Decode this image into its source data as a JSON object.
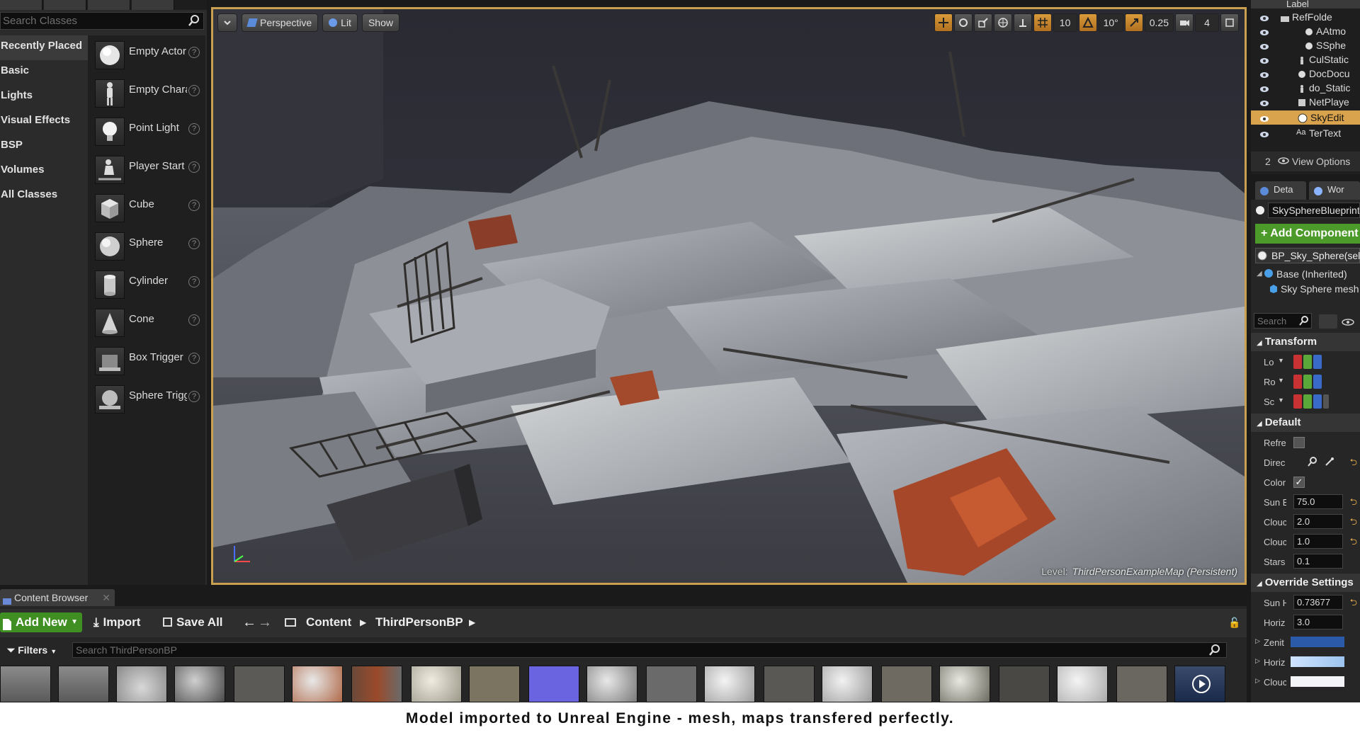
{
  "modes": {
    "search_placeholder": "Search Classes",
    "categories": [
      "Recently Placed",
      "Basic",
      "Lights",
      "Visual Effects",
      "BSP",
      "Volumes",
      "All Classes"
    ],
    "classes": [
      {
        "name": "Empty Actor",
        "icon": "sphere-icon"
      },
      {
        "name": "Empty Character",
        "icon": "character-icon"
      },
      {
        "name": "Point Light",
        "icon": "light-bulb-icon"
      },
      {
        "name": "Player Start",
        "icon": "player-start-icon"
      },
      {
        "name": "Cube",
        "icon": "cube-icon"
      },
      {
        "name": "Sphere",
        "icon": "sphere-icon"
      },
      {
        "name": "Cylinder",
        "icon": "cylinder-icon"
      },
      {
        "name": "Cone",
        "icon": "cone-icon"
      },
      {
        "name": "Box Trigger",
        "icon": "box-trigger-icon"
      },
      {
        "name": "Sphere Trigger",
        "icon": "sphere-trigger-icon"
      }
    ],
    "help_glyph": "?"
  },
  "viewport": {
    "perspective_label": "Perspective",
    "lit_label": "Lit",
    "show_label": "Show",
    "grid_snap": "10",
    "rotation_snap": "10°",
    "scale_snap": "0.25",
    "camera_speed": "4",
    "level_key": "Level:",
    "level_value": "ThirdPersonExampleMap (Persistent)"
  },
  "outliner": {
    "header": "Label",
    "rows": [
      {
        "label": "RefFolde",
        "selected": false
      },
      {
        "label": "AAtmo",
        "selected": false
      },
      {
        "label": "SSphe",
        "selected": false
      },
      {
        "label": "CulStatic",
        "selected": false
      },
      {
        "label": "DocDocu",
        "selected": false
      },
      {
        "label": "do_Static",
        "selected": false
      },
      {
        "label": "NetPlaye",
        "selected": false
      },
      {
        "label": "SkyEdit",
        "selected": true
      },
      {
        "label": "TerText",
        "selected": false
      }
    ],
    "count": "2",
    "view_options": "View Options"
  },
  "details": {
    "tab_details": "Deta",
    "tab_world": "Wor",
    "actor_name": "SkySphereBlueprint",
    "add_component": "+ Add Component",
    "self_component": "BP_Sky_Sphere(self)",
    "base_inherited": "Base (Inherited)",
    "sky_mesh": "Sky Sphere mesh",
    "search_placeholder": "Search",
    "transform_label": "Transform",
    "location_label": "Lo",
    "rotation_label": "Ro",
    "scale_label": "Sc",
    "default_label": "Default",
    "props": [
      {
        "label": "Refre",
        "value": ""
      },
      {
        "label": "Direc",
        "value": ""
      },
      {
        "label": "Color",
        "value": "✓"
      },
      {
        "label": "Sun B",
        "value": "75.0"
      },
      {
        "label": "Clouc",
        "value": "2.0"
      },
      {
        "label": "Clouc",
        "value": "1.0"
      },
      {
        "label": "Stars",
        "value": "0.1"
      }
    ],
    "override_label": "Override Settings",
    "override_props": [
      {
        "label": "Sun H",
        "value": "0.73677"
      },
      {
        "label": "Horiz",
        "value": "3.0"
      },
      {
        "label": "Zenit",
        "value": ""
      },
      {
        "label": "Horiz",
        "value": ""
      },
      {
        "label": "Clouc",
        "value": ""
      }
    ]
  },
  "content_browser": {
    "tab_label": "Content Browser",
    "add_new": "Add New",
    "import": "Import",
    "save_all": "Save All",
    "path": [
      "Content",
      "ThirdPersonBP"
    ],
    "filters_label": "Filters",
    "search_placeholder": "Search ThirdPersonBP"
  },
  "caption": "Model imported to Unreal Engine - mesh, maps transfered perfectly.",
  "colors": {
    "accent": "#d8a34c",
    "add_green": "#4c9a2a",
    "viewport_border": "#c9a050"
  }
}
